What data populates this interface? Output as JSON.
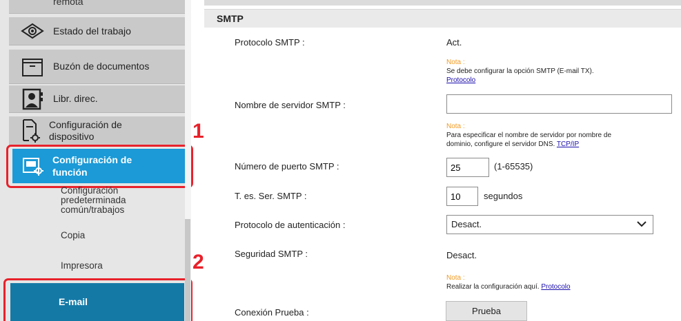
{
  "sidebar": {
    "top_partial_label": "remota",
    "items": [
      {
        "label": "Estado del trabajo",
        "icon": "eye-icon"
      },
      {
        "label": "Buzón de documentos",
        "icon": "folder-icon"
      },
      {
        "label": "Libr. direc.",
        "icon": "address-book-icon"
      },
      {
        "label_line1": "Configuración de",
        "label_line2": "dispositivo",
        "icon": "device-settings-icon"
      }
    ],
    "active": {
      "label_line1": "Configuración de",
      "label_line2": "función",
      "icon": "function-settings-icon"
    },
    "sub_items": [
      {
        "label_line1": "Configuración",
        "label_line2": "predeterminada",
        "label_line3": "común/trabajos"
      },
      {
        "label": "Copia"
      },
      {
        "label": "Impresora"
      }
    ],
    "email_label": "E-mail",
    "step1": "1",
    "step2": "2"
  },
  "smtp": {
    "section_title": "SMTP",
    "protocol_label": "Protocolo SMTP :",
    "protocol_value": "Act.",
    "note1": {
      "title": "Nota :",
      "text": "Se debe configurar la opción SMTP (E-mail TX).",
      "link": "Protocolo"
    },
    "server_label": "Nombre de servidor SMTP :",
    "server_value": "",
    "note2": {
      "title": "Nota :",
      "line1": "Para especificar el nombre de servidor por nombre de",
      "line2": "dominio, configure el servidor DNS.",
      "link": "TCP/IP"
    },
    "port_label": "Número de puerto SMTP :",
    "port_value": "25",
    "port_range": "(1-65535)",
    "timeout_label": "T. es. Ser. SMTP :",
    "timeout_value": "10",
    "timeout_unit": "segundos",
    "auth_label": "Protocolo de autenticación :",
    "auth_value": "Desact.",
    "security_label": "Seguridad SMTP :",
    "security_value": "Desact.",
    "note3": {
      "title": "Nota :",
      "text": "Realizar la configuración aquí.",
      "link": "Protocolo"
    },
    "test_label": "Conexión Prueba :",
    "test_button": "Prueba"
  },
  "colors": {
    "accent": "#1b9ad7",
    "email_active": "#1579a6",
    "highlight": "#e8212a",
    "note": "#f39a21"
  }
}
